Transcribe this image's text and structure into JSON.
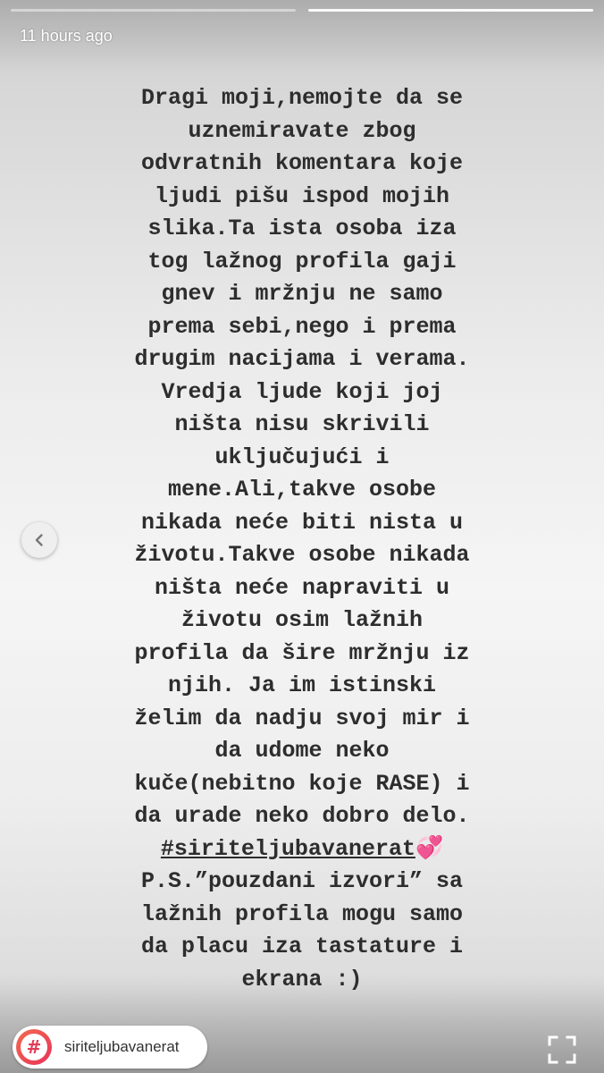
{
  "progress": {
    "segments": 2,
    "active_index": 1
  },
  "story": {
    "timestamp": "11 hours ago",
    "lines": [
      "Dragi moji,nemojte da se",
      "uznemiravate zbog",
      "odvratnih komentara koje",
      "ljudi pišu ispod mojih",
      "slika.Ta ista osoba iza",
      "tog lažnog profila gaji",
      "gnev i mržnju ne samo",
      "prema sebi,nego i prema",
      "drugim nacijama i verama.",
      "Vredja ljude koji joj",
      "ništa nisu skrivili",
      "uključujući i",
      "mene.Ali,takve osobe",
      "nikada neće biti nista u",
      "životu.Takve osobe nikada",
      "ništa neće napraviti u",
      "životu osim lažnih",
      "profila da šire mržnju iz",
      "njih. Ja im istinski",
      "želim da nadju svoj mir i",
      "da udome neko",
      "kuče(nebitno koje RASE) i",
      "da urade neko dobro delo."
    ],
    "hashtag": "#siriteljubavanerat",
    "hashtag_emoji": "💞",
    "ps_lines": [
      "P.S.”pouzdani izvori” sa",
      "lažnih profila mogu samo",
      "da placu iza tastature i",
      "ekrana :)"
    ]
  },
  "hashtag_sticker": {
    "symbol": "#",
    "label": "siriteljubavanerat"
  },
  "icons": {
    "prev": "chevron-left-icon",
    "fullscreen": "fullscreen-icon",
    "hashtag": "hashtag-icon"
  },
  "colors": {
    "text": "#2d2d2d",
    "accent": "#e8335a",
    "heart": "#ff5fbf"
  }
}
